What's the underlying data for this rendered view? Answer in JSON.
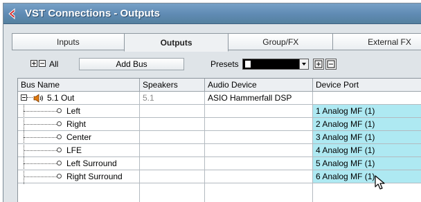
{
  "window": {
    "title": "VST Connections - Outputs"
  },
  "tabs": [
    {
      "label": "Inputs",
      "active": false
    },
    {
      "label": "Outputs",
      "active": true
    },
    {
      "label": "Group/FX",
      "active": false
    },
    {
      "label": "External FX",
      "active": false
    }
  ],
  "toolbar": {
    "all_label": "All",
    "add_bus_label": "Add Bus",
    "presets_label": "Presets",
    "presets_value": ""
  },
  "table": {
    "columns": [
      "Bus Name",
      "Speakers",
      "Audio Device",
      "Device Port"
    ],
    "bus": {
      "name": "5.1 Out",
      "speakers": "5.1",
      "device": "ASIO Hammerfall DSP",
      "port": ""
    },
    "channels": [
      {
        "name": "Left",
        "port": "1 Analog MF (1)"
      },
      {
        "name": "Right",
        "port": "2 Analog MF (1)"
      },
      {
        "name": "Center",
        "port": "3 Analog MF (1)"
      },
      {
        "name": "LFE",
        "port": "4 Analog MF (1)"
      },
      {
        "name": "Left Surround",
        "port": "5 Analog MF (1)"
      },
      {
        "name": "Right Surround",
        "port": "6 Analog MF (1)"
      }
    ]
  },
  "colors": {
    "title_bar": "#6a93bb",
    "port_highlight": "#aee9f2",
    "title_icon": "#d42020"
  }
}
